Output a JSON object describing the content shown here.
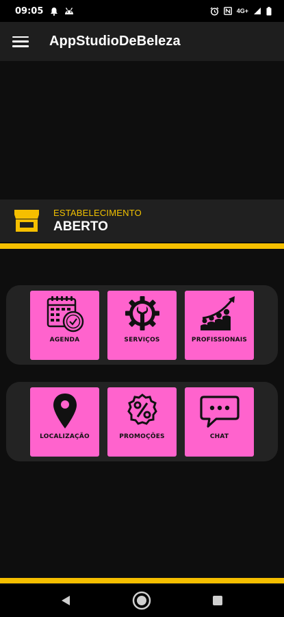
{
  "status_bar": {
    "time": "09:05",
    "network": "4G+",
    "icons": [
      "notification-bell-icon",
      "android-debug-icon",
      "alarm-icon",
      "nfc-icon",
      "signal-icon",
      "battery-icon"
    ]
  },
  "app_bar": {
    "title": "AppStudioDeBeleza",
    "menu_icon": "hamburger-menu-icon"
  },
  "establishment": {
    "label": "ESTABELECIMENTO",
    "status": "ABERTO",
    "icon": "storefront-icon"
  },
  "menu_rows": [
    {
      "tiles": [
        {
          "label": "AGENDA",
          "icon": "calendar-clock-icon"
        },
        {
          "label": "SERVIÇOS",
          "icon": "gear-wrench-icon"
        },
        {
          "label": "PROFISSIONAIS",
          "icon": "team-growth-icon"
        }
      ]
    },
    {
      "tiles": [
        {
          "label": "LOCALIZAÇÃO",
          "icon": "location-pin-icon"
        },
        {
          "label": "PROMOÇÕES",
          "icon": "percent-badge-icon"
        },
        {
          "label": "CHAT",
          "icon": "chat-bubble-icon"
        }
      ]
    }
  ],
  "colors": {
    "accent": "#f5bf00",
    "tile": "#ff63cd",
    "background": "#0e0e0e",
    "appbar": "#1e1e1e"
  }
}
